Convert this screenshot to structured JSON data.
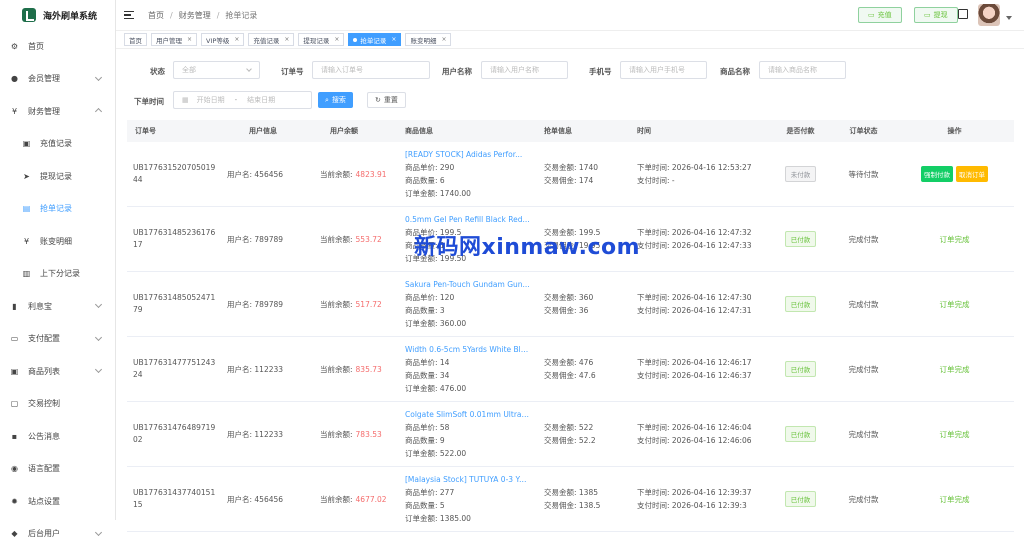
{
  "app": {
    "title": "海外刷单系统"
  },
  "sidebar": {
    "items": [
      {
        "label": "首页",
        "icon": "dashboard-icon"
      },
      {
        "label": "会员管理",
        "icon": "user-icon",
        "expandable": true
      },
      {
        "label": "财务管理",
        "icon": "yen-icon",
        "expandable": true,
        "expanded": true
      },
      {
        "label": "充值记录",
        "icon": "cart-icon",
        "sub": true
      },
      {
        "label": "提现记录",
        "icon": "send-icon",
        "sub": true
      },
      {
        "label": "抢单记录",
        "icon": "book-icon",
        "sub": true,
        "active": true
      },
      {
        "label": "账变明细",
        "icon": "yen-icon",
        "sub": true
      },
      {
        "label": "上下分记录",
        "icon": "document-icon",
        "sub": true
      },
      {
        "label": "利息宝",
        "icon": "chart-icon",
        "expandable": true
      },
      {
        "label": "支付配置",
        "icon": "wallet-icon",
        "expandable": true
      },
      {
        "label": "商品列表",
        "icon": "cart-icon",
        "expandable": true
      },
      {
        "label": "交易控制",
        "icon": "monitor-icon"
      },
      {
        "label": "公告消息",
        "icon": "message-icon"
      },
      {
        "label": "语言配置",
        "icon": "globe-icon"
      },
      {
        "label": "站点设置",
        "icon": "gear-icon"
      },
      {
        "label": "后台用户",
        "icon": "admin-icon",
        "expandable": true
      }
    ]
  },
  "header": {
    "breadcrumb": [
      "首页",
      "财务管理",
      "抢单记录"
    ],
    "recharge_label": "充值",
    "withdraw_label": "提现"
  },
  "tabs": [
    {
      "label": "首页",
      "closable": false
    },
    {
      "label": "用户管理",
      "closable": true
    },
    {
      "label": "VIP等级",
      "closable": true
    },
    {
      "label": "充值记录",
      "closable": true
    },
    {
      "label": "提现记录",
      "closable": true
    },
    {
      "label": "抢单记录",
      "closable": true,
      "active": true
    },
    {
      "label": "账变明细",
      "closable": true
    }
  ],
  "filters": {
    "status_label": "状态",
    "status_value": "全部",
    "order_label": "订单号",
    "order_placeholder": "请输入订单号",
    "username_label": "用户名称",
    "username_placeholder": "请输入用户名称",
    "phone_label": "手机号",
    "phone_placeholder": "请输入用户手机号",
    "goods_label": "商品名称",
    "goods_placeholder": "请输入商品名称",
    "time_label": "下单时间",
    "start_placeholder": "开始日期",
    "range_sep": "-",
    "end_placeholder": "结束日期",
    "search_label": "搜索",
    "reset_label": "重置"
  },
  "table": {
    "columns": [
      "订单号",
      "用户信息",
      "用户余额",
      "商品信息",
      "抢单信息",
      "时间",
      "是否付款",
      "订单状态",
      "操作"
    ],
    "rows": [
      {
        "order_id": "UB17763152070501944",
        "user": "用户名: 456456",
        "balance_label": "当前余额:",
        "balance": "4823.91",
        "goods_title": "[READY STOCK] Adidas Perfor...",
        "unit_price": "商品单价: 290",
        "qty": "商品数量: 6",
        "amount": "订单金额: 1740.00",
        "trade_amount": "交易金额: 1740",
        "commission": "交易佣金: 174",
        "order_time": "下单时间: 2026-04-16 12:53:27",
        "pay_time": "支付时间: -",
        "paid": "未付款",
        "paid_state": "unpaid",
        "status": "等待付款",
        "op1": "强制付款",
        "op2": "取消订单"
      },
      {
        "order_id": "UB17763148523617617",
        "user": "用户名: 789789",
        "balance_label": "当前余额:",
        "balance": "553.72",
        "goods_title": "0.5mm Gel Pen Refill Black Red...",
        "unit_price": "商品单价: 199.5",
        "qty": "商品数量: 1",
        "amount": "订单金额: 199.50",
        "trade_amount": "交易金额: 199.5",
        "commission": "交易佣金: 19.95",
        "order_time": "下单时间: 2026-04-16 12:47:32",
        "pay_time": "支付时间: 2026-04-16 12:47:33",
        "paid": "已付款",
        "paid_state": "paid",
        "status": "完成付款",
        "op1": "订单完成"
      },
      {
        "order_id": "UB17763148505247179",
        "user": "用户名: 789789",
        "balance_label": "当前余额:",
        "balance": "517.72",
        "goods_title": "Sakura Pen-Touch Gundam Gun...",
        "unit_price": "商品单价: 120",
        "qty": "商品数量: 3",
        "amount": "订单金额: 360.00",
        "trade_amount": "交易金额: 360",
        "commission": "交易佣金: 36",
        "order_time": "下单时间: 2026-04-16 12:47:30",
        "pay_time": "支付时间: 2026-04-16 12:47:31",
        "paid": "已付款",
        "paid_state": "paid",
        "status": "完成付款",
        "op1": "订单完成"
      },
      {
        "order_id": "UB17763147775124324",
        "user": "用户名: 112233",
        "balance_label": "当前余额:",
        "balance": "835.73",
        "goods_title": "Width 0.6-5cm 5Yards White Bla...",
        "unit_price": "商品单价: 14",
        "qty": "商品数量: 34",
        "amount": "订单金额: 476.00",
        "trade_amount": "交易金额: 476",
        "commission": "交易佣金: 47.6",
        "order_time": "下单时间: 2026-04-16 12:46:17",
        "pay_time": "支付时间: 2026-04-16 12:46:37",
        "paid": "已付款",
        "paid_state": "paid",
        "status": "完成付款",
        "op1": "订单完成"
      },
      {
        "order_id": "UB17763147648971902",
        "user": "用户名: 112233",
        "balance_label": "当前余额:",
        "balance": "783.53",
        "goods_title": "Colgate SlimSoft 0.01mm Ultra ...",
        "unit_price": "商品单价: 58",
        "qty": "商品数量: 9",
        "amount": "订单金额: 522.00",
        "trade_amount": "交易金额: 522",
        "commission": "交易佣金: 52.2",
        "order_time": "下单时间: 2026-04-16 12:46:04",
        "pay_time": "支付时间: 2026-04-16 12:46:06",
        "paid": "已付款",
        "paid_state": "paid",
        "status": "完成付款",
        "op1": "订单完成"
      },
      {
        "order_id": "UB17763143774015115",
        "user": "用户名: 456456",
        "balance_label": "当前余额:",
        "balance": "4677.02",
        "goods_title": "[Malaysia Stock] TUTUYA 0-3 Ye...",
        "unit_price": "商品单价: 277",
        "qty": "商品数量: 5",
        "amount": "订单金额: 1385.00",
        "trade_amount": "交易金额: 1385",
        "commission": "交易佣金: 138.5",
        "order_time": "下单时间: 2026-04-16 12:39:37",
        "pay_time": "支付时间: 2026-04-16 12:39:3",
        "paid": "已付款",
        "paid_state": "paid",
        "status": "完成付款",
        "op1": "订单完成"
      }
    ]
  },
  "watermark": "新码网xinmaw.com"
}
